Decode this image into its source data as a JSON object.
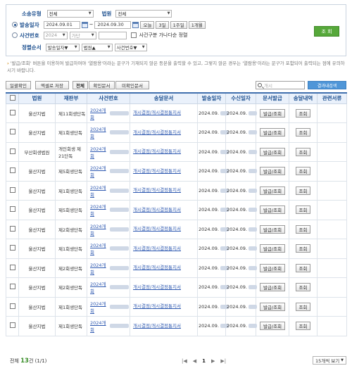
{
  "search": {
    "type_label": "소송유형",
    "type_value": "전체",
    "court_label": "법원",
    "court_value": "전체",
    "send_date_label": "발송일자",
    "date_from": "2024.09.01",
    "date_sep": "~",
    "date_to": "2024.09.30",
    "btn_today": "오늘",
    "btn_3days": "3일",
    "btn_1week": "1주일",
    "btn_1month": "1개월",
    "case_no_label": "사건번호",
    "case_year": "2024",
    "case_type": "가단",
    "case_no_value": "",
    "sort_by_case_label": "사건구분 가나다순 정렬",
    "order_label": "정렬순서",
    "order1": "발송일자▼",
    "order2": "법원▲",
    "order3": "사건번호▼",
    "submit_label": "조 회"
  },
  "notice": {
    "mark": "›",
    "text": "'발급/조회' 버튼을 이용하여 발급하여야 '열람용'이라는 문구가 기재되지 않은 등본을 출력할 수 있고, 그렇지 않은 경우는 '열람용'이라는 문구가 포함되어 출력되는 점에 유의하시기 바랍니다."
  },
  "toolbar": {
    "bulk_confirm": "일괄확인",
    "excel_save": "엑셀로 저장",
    "tab_all": "전체",
    "tab_confirmed": "확인문서",
    "tab_unconfirmed": "미확인문서",
    "search_placeholder": "개시",
    "result_search": "결과내검색"
  },
  "table": {
    "headers": [
      "법원",
      "재판부",
      "사건번호",
      "송달문서",
      "발송일자",
      "수신일자",
      "문서발급",
      "송달내역",
      "관련서류"
    ],
    "rows": [
      {
        "court": "울산지법",
        "division": "제11회생단독",
        "case": "2024개회",
        "doc": "개시결정/개시결정통지서",
        "sent": "2024.09.",
        "recv": "2024.09.",
        "issue": "발급/조회",
        "history": "조회"
      },
      {
        "court": "울산지법",
        "division": "제1회생단독",
        "case": "2024개회",
        "doc": "개시결정/개시결정통지서",
        "sent": "2024.09.",
        "recv": "2024.09.",
        "issue": "발급/조회",
        "history": "조회"
      },
      {
        "court": "부산회생법원",
        "division": "개인회생 제21단독",
        "case": "2024개회",
        "doc": "개시결정/개시결정통지서",
        "sent": "2024.09.",
        "recv": "2024.09.",
        "issue": "발급/조회",
        "history": "조회"
      },
      {
        "court": "울산지법",
        "division": "제5회생단독",
        "case": "2024개회",
        "doc": "개시결정/개시결정통지서",
        "sent": "2024.09.",
        "recv": "2024.09.",
        "issue": "발급/조회",
        "history": "조회"
      },
      {
        "court": "울산지법",
        "division": "제1회생단독",
        "case": "2024개회",
        "doc": "개시결정/개시결정통지서",
        "sent": "2024.09.",
        "recv": "2024.09.",
        "issue": "발급/조회",
        "history": "조회"
      },
      {
        "court": "울산지법",
        "division": "제5회생단독",
        "case": "2024개회",
        "doc": "개시결정/개시결정통지서",
        "sent": "2024.09.",
        "recv": "2024.09.",
        "issue": "발급/조회",
        "history": "조회"
      },
      {
        "court": "울산지법",
        "division": "제2회생단독",
        "case": "2024개회",
        "doc": "개시결정/개시결정통지서",
        "sent": "2024.09.",
        "recv": "2024.09.",
        "issue": "발급/조회",
        "history": "조회"
      },
      {
        "court": "울산지법",
        "division": "제1회생단독",
        "case": "2024개회",
        "doc": "개시결정/개시결정통지서",
        "sent": "2024.09.",
        "recv": "2024.09.",
        "issue": "발급/조회",
        "history": "조회"
      },
      {
        "court": "울산지법",
        "division": "제2회생단독",
        "case": "2024개회",
        "doc": "개시결정/개시결정통지서",
        "sent": "2024.09.",
        "recv": "2024.09.",
        "issue": "발급/조회",
        "history": "조회"
      },
      {
        "court": "울산지법",
        "division": "제2회생단독",
        "case": "2024개회",
        "doc": "개시결정/개시결정통지서",
        "sent": "2024.09.",
        "recv": "2024.09.",
        "issue": "발급/조회",
        "history": "조회"
      },
      {
        "court": "울산지법",
        "division": "제1회생단독",
        "case": "2024개회",
        "doc": "개시결정/개시결정통지서",
        "sent": "2024.09.",
        "recv": "2024.09.",
        "issue": "발급/조회",
        "history": "조회"
      },
      {
        "court": "울산지법",
        "division": "제1회생단독",
        "case": "2024개회",
        "doc": "개시결정/개시결정통지서",
        "sent": "2024.09.",
        "recv": "2024.09.",
        "issue": "발급/조회",
        "history": "조회"
      }
    ]
  },
  "footer": {
    "total_prefix": "전체",
    "total_count": "13",
    "total_suffix": "건",
    "page_info": "(1/1)",
    "first": "|◀",
    "prev": "◀",
    "current_page": "1",
    "next": "▶",
    "last": "▶|",
    "per_page": "15개씩 보기"
  }
}
